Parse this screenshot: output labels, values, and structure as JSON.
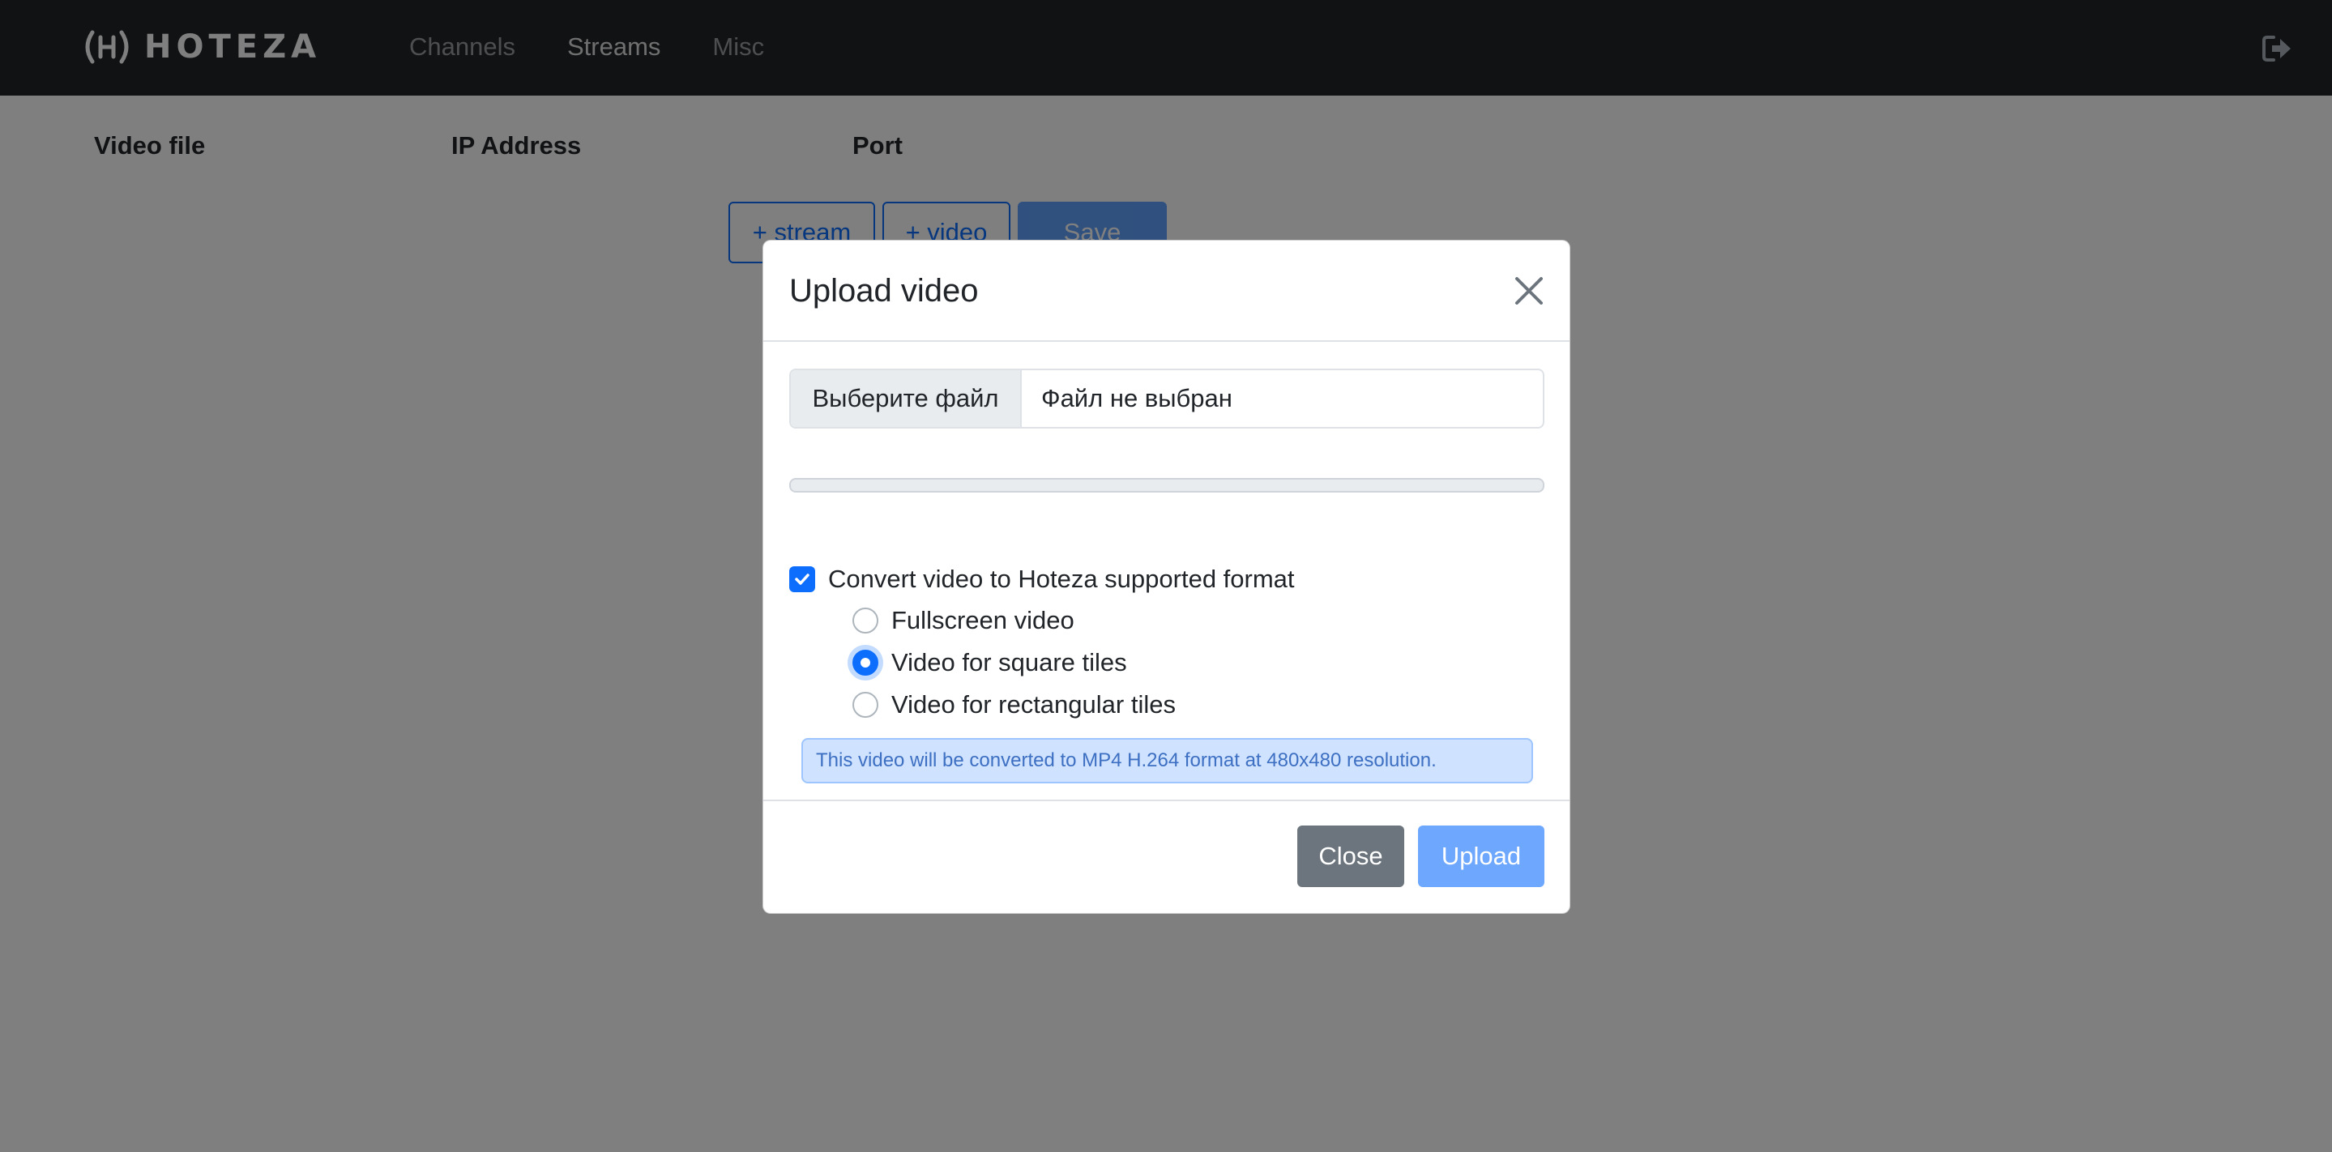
{
  "navbar": {
    "brand": "HOTEZA",
    "links": [
      {
        "label": "Channels",
        "active": false
      },
      {
        "label": "Streams",
        "active": true
      },
      {
        "label": "Misc",
        "active": false
      }
    ],
    "logout_icon": "sign-out-icon"
  },
  "page": {
    "columns": [
      "Video file",
      "IP Address",
      "Port"
    ],
    "buttons": {
      "add_stream": "+ stream",
      "add_video": "+ video",
      "save": "Save"
    }
  },
  "modal": {
    "title": "Upload video",
    "close_icon": "close-icon",
    "file_input": {
      "button_label": "Выберите файл",
      "status": "Файл не выбран"
    },
    "progress_percent": 0,
    "convert": {
      "label": "Convert video to Hoteza supported format",
      "checked": true
    },
    "options": [
      {
        "label": "Fullscreen video",
        "checked": false
      },
      {
        "label": "Video for square tiles",
        "checked": true
      },
      {
        "label": "Video for rectangular tiles",
        "checked": false
      }
    ],
    "info": "This video will be converted to MP4 H.264 format at 480x480 resolution.",
    "footer": {
      "close_label": "Close",
      "upload_label": "Upload"
    }
  },
  "colors": {
    "navbar_bg": "#212529",
    "primary": "#0d6efd",
    "secondary": "#6c757d",
    "upload_disabled": "#6ea8fe",
    "info_bg": "#cfe2ff"
  }
}
